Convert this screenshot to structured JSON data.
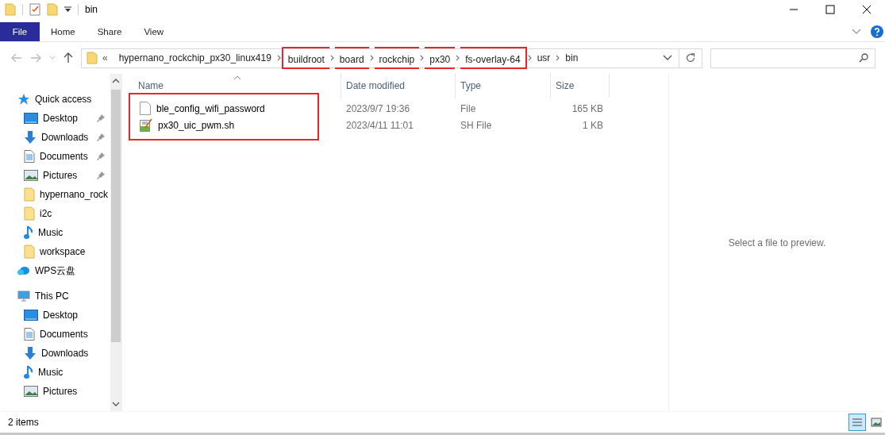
{
  "window": {
    "title": "bin"
  },
  "ribbon_tabs": [
    {
      "label": "File",
      "kind": "file",
      "selected": false
    },
    {
      "label": "Home",
      "kind": "tab",
      "selected": false
    },
    {
      "label": "Share",
      "kind": "tab",
      "selected": false
    },
    {
      "label": "View",
      "kind": "tab",
      "selected": false
    }
  ],
  "address": {
    "prefix": "«",
    "segments": [
      {
        "label": "hypernano_rockchip_px30_linux419",
        "highlighted": false
      },
      {
        "label": "buildroot",
        "highlighted": true
      },
      {
        "label": "board",
        "highlighted": true
      },
      {
        "label": "rockchip",
        "highlighted": true
      },
      {
        "label": "px30",
        "highlighted": true
      },
      {
        "label": "fs-overlay-64",
        "highlighted": true
      },
      {
        "label": "usr",
        "highlighted": false
      },
      {
        "label": "bin",
        "highlighted": false
      }
    ]
  },
  "sidebar": [
    {
      "label": "Quick access",
      "kind": "star",
      "children": [
        {
          "label": "Desktop",
          "kind": "desktop",
          "pinned": true
        },
        {
          "label": "Downloads",
          "kind": "download",
          "pinned": true
        },
        {
          "label": "Documents",
          "kind": "document",
          "pinned": true
        },
        {
          "label": "Pictures",
          "kind": "pictures",
          "pinned": true
        },
        {
          "label": "hypernano_rock",
          "kind": "folder",
          "pinned": false
        },
        {
          "label": "i2c",
          "kind": "folder",
          "pinned": false
        },
        {
          "label": "Music",
          "kind": "music",
          "pinned": false
        },
        {
          "label": "workspace",
          "kind": "folder",
          "pinned": false
        }
      ]
    },
    {
      "label": "WPS云盘",
      "kind": "cloud"
    },
    {
      "label": "This PC",
      "kind": "pc",
      "children": [
        {
          "label": "Desktop",
          "kind": "desktop",
          "pinned": false
        },
        {
          "label": "Documents",
          "kind": "document",
          "pinned": false
        },
        {
          "label": "Downloads",
          "kind": "download",
          "pinned": false
        },
        {
          "label": "Music",
          "kind": "music",
          "pinned": false
        },
        {
          "label": "Pictures",
          "kind": "pictures",
          "pinned": false
        }
      ]
    }
  ],
  "table": {
    "columns": [
      "Name",
      "Date modified",
      "Type",
      "Size"
    ],
    "rows": [
      {
        "kind": "file",
        "name": "ble_config_wifi_password",
        "date": "2023/9/7 19:36",
        "type": "File",
        "size": "165 KB"
      },
      {
        "kind": "script",
        "name": "px30_uic_pwm.sh",
        "date": "2023/4/11 11:01",
        "type": "SH File",
        "size": "1 KB"
      }
    ]
  },
  "preview": {
    "message": "Select a file to preview."
  },
  "status_bar": {
    "text": "2 items"
  }
}
